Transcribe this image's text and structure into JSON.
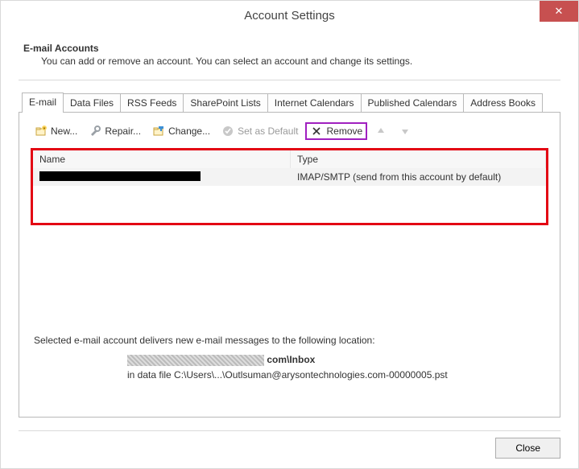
{
  "window": {
    "title": "Account Settings",
    "close_glyph": "✕"
  },
  "header": {
    "heading": "E-mail Accounts",
    "sub": "You can add or remove an account. You can select an account and change its settings."
  },
  "tabs": [
    {
      "label": "E-mail",
      "active": true
    },
    {
      "label": "Data Files"
    },
    {
      "label": "RSS Feeds"
    },
    {
      "label": "SharePoint Lists"
    },
    {
      "label": "Internet Calendars"
    },
    {
      "label": "Published Calendars"
    },
    {
      "label": "Address Books"
    }
  ],
  "toolbar": {
    "new": "New...",
    "repair": "Repair...",
    "change": "Change...",
    "set_default": "Set as Default",
    "remove": "Remove"
  },
  "list": {
    "col_name": "Name",
    "col_type": "Type",
    "rows": [
      {
        "name": "[redacted]",
        "type": "IMAP/SMTP (send from this account by default)"
      }
    ]
  },
  "delivery": {
    "intro": "Selected e-mail account delivers new e-mail messages to the following location:",
    "suffix_bold": "com\\Inbox",
    "path": "in data file C:\\Users\\...\\Outlsuman@arysontechnologies.com-00000005.pst"
  },
  "footer": {
    "close": "Close"
  }
}
